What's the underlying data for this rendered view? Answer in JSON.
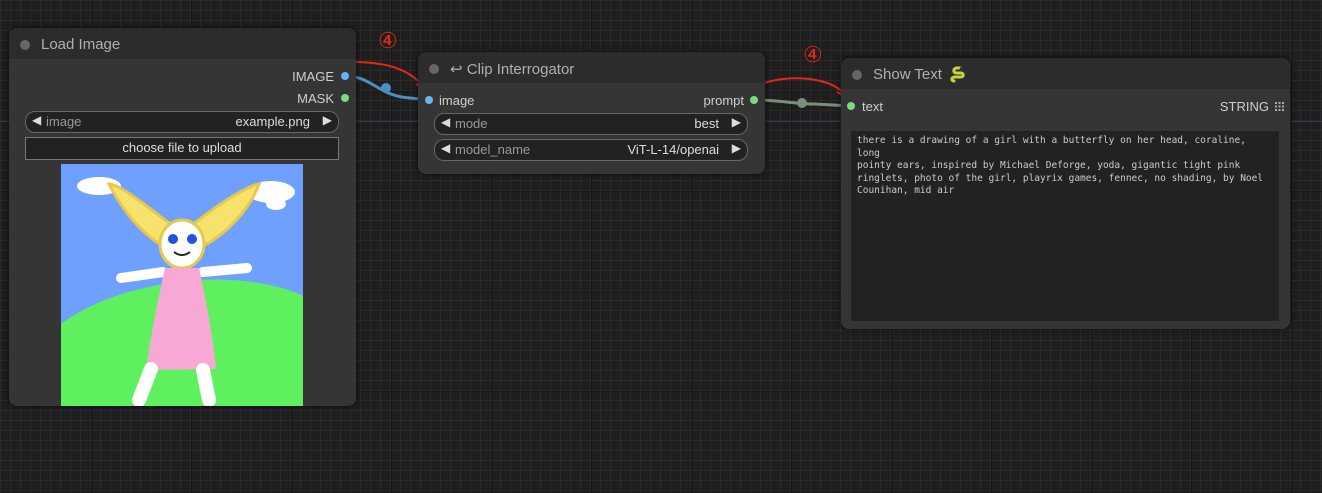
{
  "load_image": {
    "title": "Load Image",
    "outputs": [
      "IMAGE",
      "MASK"
    ],
    "image_widget": {
      "label": "image",
      "value": "example.png"
    },
    "upload_label": "choose file to upload"
  },
  "clip_interrogator": {
    "title": "↩ Clip Interrogator",
    "input": "image",
    "output": "prompt",
    "mode_widget": {
      "label": "mode",
      "value": "best"
    },
    "model_widget": {
      "label": "model_name",
      "value": "ViT-L-14/openai"
    }
  },
  "show_text": {
    "title": "Show Text",
    "icon": "snake-icon",
    "input": "text",
    "output": "STRING",
    "text": "there is a drawing of a girl with a butterfly on her head, coraline, long\npointy ears, inspired by Michael Deforge, yoda, gigantic tight pink\nringlets, photo of the girl, playrix games, fennec, no shading, by Noel\nCounihan, mid air"
  },
  "annotations": {
    "badge_1": "④",
    "badge_2": "④"
  },
  "colors": {
    "image_link": "#64b5f6",
    "string_link": "#8a9a8a",
    "annotation": "#e0281a"
  }
}
